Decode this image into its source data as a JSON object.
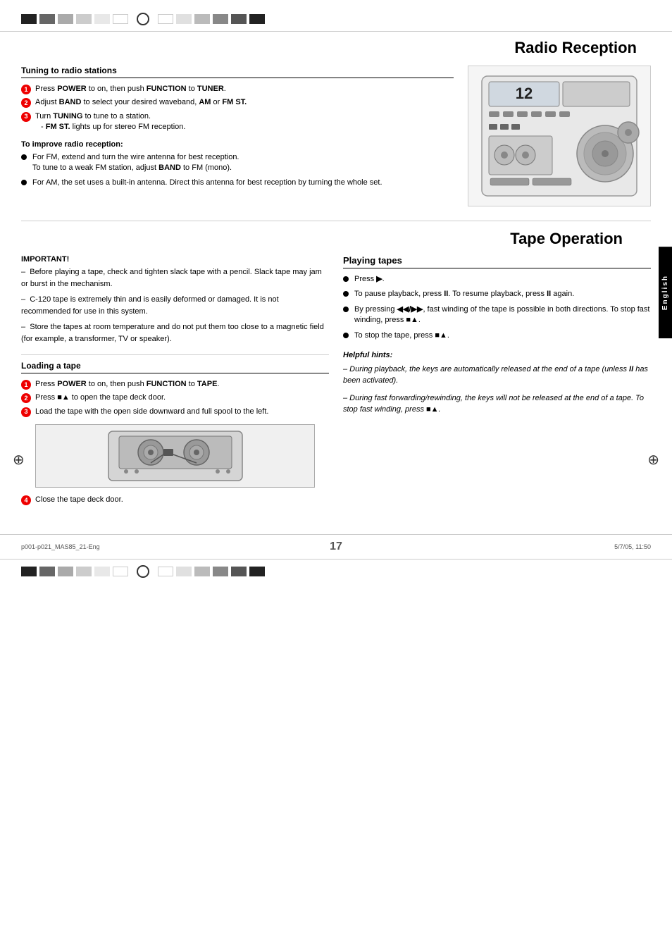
{
  "page": {
    "number": "17",
    "bottom_left": "p001-p021_MAS85_21-Eng",
    "bottom_center": "17",
    "bottom_right": "5/7/05, 11:50"
  },
  "right_tab": {
    "label": "English"
  },
  "radio_reception": {
    "section_title": "Radio Reception",
    "tuning_title": "Tuning to radio stations",
    "steps": [
      {
        "num": "1",
        "text": "Press POWER to on, then push FUNCTION to TUNER."
      },
      {
        "num": "2",
        "text": "Adjust BAND to select your desired waveband, AM or FM ST."
      },
      {
        "num": "3",
        "text": "Turn TUNING to tune to a station.",
        "sub": "- FM ST. lights up for stereo FM reception."
      }
    ],
    "improve_title": "To improve radio reception:",
    "improve_bullets": [
      {
        "text": "For FM, extend and turn the wire antenna for best reception. To tune to a weak FM station, adjust BAND to FM (mono)."
      },
      {
        "text": "For AM, the set uses a built-in antenna. Direct this antenna for best reception by turning the whole set."
      }
    ]
  },
  "tape_operation": {
    "section_title": "Tape Operation",
    "important_title": "IMPORTANT!",
    "important_bullets": [
      "Before playing a tape, check and tighten slack tape with a pencil. Slack tape may jam or burst in the mechanism.",
      "C-120 tape is extremely thin and is easily deformed or damaged. It is not recommended for use in this system.",
      "Store the tapes at room temperature and do not put them too close to a magnetic field (for example, a transformer, TV or speaker)."
    ],
    "loading_title": "Loading a tape",
    "loading_steps": [
      {
        "num": "1",
        "text": "Press POWER to on, then push FUNCTION to TAPE."
      },
      {
        "num": "2",
        "text": "Press ■▲ to open the tape deck door."
      },
      {
        "num": "3",
        "text": "Load the tape with the open side downward and full spool to the left."
      },
      {
        "num": "4",
        "text": "Close the tape deck door."
      }
    ],
    "playing_title": "Playing tapes",
    "playing_bullets": [
      {
        "text": "Press ▶."
      },
      {
        "text": "To pause playback, press II. To resume playback, press II again."
      },
      {
        "text": "By pressing ◀◀/▶▶, fast winding of the tape is possible in both directions. To stop fast winding, press ■▲."
      },
      {
        "text": "To stop the tape, press ■▲."
      }
    ],
    "helpful_title": "Helpful hints:",
    "helpful_bullets": [
      "During playback, the keys are automatically released at the end of a tape (unless II has been activated).",
      "During fast forwarding/rewinding, the keys will not be released at the end of a tape. To stop fast winding, press ■▲."
    ]
  }
}
